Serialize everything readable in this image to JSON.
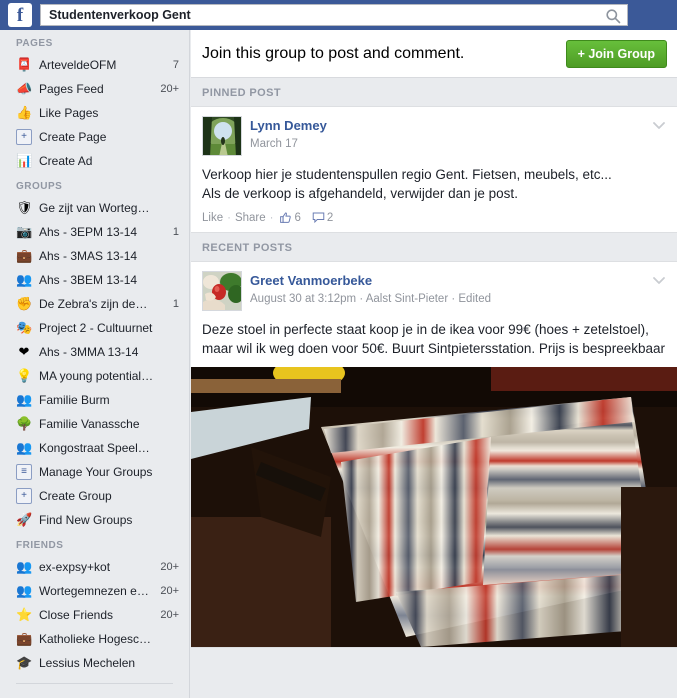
{
  "header": {
    "logo_text": "f",
    "logo_icon": "facebook-logo-icon",
    "search_value": "Studentenverkoop Gent",
    "search_placeholder": "Search",
    "search_icon": "search-icon",
    "bar_color": "#3b5998"
  },
  "sidebar": {
    "sections": [
      {
        "title": "Pages",
        "items": [
          {
            "label": "ArteveldeOFM",
            "icon": "stamp-icon",
            "glyph": "📮",
            "badge": "7",
            "boxed": false
          },
          {
            "label": "Pages Feed",
            "icon": "megaphone-icon",
            "glyph": "📣",
            "badge": "20+",
            "boxed": false
          },
          {
            "label": "Like Pages",
            "icon": "thumbs-up-icon",
            "glyph": "👍",
            "badge": "",
            "boxed": false
          },
          {
            "label": "Create Page",
            "icon": "plus-page-icon",
            "glyph": "+",
            "badge": "",
            "boxed": true
          },
          {
            "label": "Create Ad",
            "icon": "bar-chart-icon",
            "glyph": "📊",
            "badge": "",
            "boxed": false
          }
        ]
      },
      {
        "title": "Groups",
        "items": [
          {
            "label": "Ge zijt van Worteg…",
            "icon": "shield-icon",
            "glyph": "🛡",
            "badge": "",
            "boxed": false
          },
          {
            "label": "Ahs - 3EPM 13-14",
            "icon": "camera-icon",
            "glyph": "📷",
            "badge": "1",
            "boxed": false
          },
          {
            "label": "Ahs - 3MAS 13-14",
            "icon": "briefcase-icon",
            "glyph": "💼",
            "badge": "",
            "boxed": false
          },
          {
            "label": "Ahs - 3BEM 13-14",
            "icon": "group-icon",
            "glyph": "👥",
            "badge": "",
            "boxed": false
          },
          {
            "label": "De Zebra's zijn de…",
            "icon": "raised-fist-icon",
            "glyph": "✊",
            "badge": "1",
            "boxed": false
          },
          {
            "label": "Project 2 - Cultuurnet",
            "icon": "theater-masks-icon",
            "glyph": "🎭",
            "badge": "",
            "boxed": false
          },
          {
            "label": "Ahs - 3MMA 13-14",
            "icon": "heart-icon",
            "glyph": "❤",
            "badge": "",
            "boxed": false
          },
          {
            "label": "MA young potential…",
            "icon": "lightbulb-icon",
            "glyph": "💡",
            "badge": "",
            "boxed": false
          },
          {
            "label": "Familie Burm",
            "icon": "group-icon",
            "glyph": "👥",
            "badge": "",
            "boxed": false
          },
          {
            "label": "Familie Vanassche",
            "icon": "tree-icon",
            "glyph": "🌳",
            "badge": "",
            "boxed": false
          },
          {
            "label": "Kongostraat Speel…",
            "icon": "group-icon",
            "glyph": "👥",
            "badge": "",
            "boxed": false
          },
          {
            "label": "Manage Your Groups",
            "icon": "list-icon",
            "glyph": "≡",
            "badge": "",
            "boxed": true
          },
          {
            "label": "Create Group",
            "icon": "plus-group-icon",
            "glyph": "+",
            "badge": "",
            "boxed": true
          },
          {
            "label": "Find New Groups",
            "icon": "rocket-icon",
            "glyph": "🚀",
            "badge": "",
            "boxed": false
          }
        ]
      },
      {
        "title": "Friends",
        "items": [
          {
            "label": "ex-expsy+kot",
            "icon": "friend-list-icon",
            "glyph": "👥",
            "badge": "20+",
            "boxed": false
          },
          {
            "label": "Wortegemnezen e…",
            "icon": "friend-list-icon",
            "glyph": "👥",
            "badge": "20+",
            "boxed": false
          },
          {
            "label": "Close Friends",
            "icon": "star-icon",
            "glyph": "⭐",
            "badge": "20+",
            "boxed": false
          },
          {
            "label": "Katholieke Hogesc…",
            "icon": "briefcase-icon",
            "glyph": "💼",
            "badge": "",
            "boxed": false
          },
          {
            "label": "Lessius Mechelen",
            "icon": "graduation-cap-icon",
            "glyph": "🎓",
            "badge": "",
            "boxed": false
          }
        ]
      }
    ]
  },
  "main": {
    "join_bar": {
      "text": "Join this group to post and comment.",
      "button_label": "+ Join Group",
      "button_color": "#59ab2e"
    },
    "pinned_label": "Pinned Post",
    "recent_label": "Recent Posts",
    "posts": [
      {
        "author": "Lynn Demey",
        "subtitle": "March 17",
        "avatar_icon": "avatar-nature-path",
        "body": "Verkoop hier je studentenspullen regio Gent. Fietsen, meubels, etc...\nAls de verkoop is afgehandeld, verwijder dan je post.",
        "like_label": "Like",
        "share_label": "Share",
        "like_count": "6",
        "comment_count": "2",
        "menu_icon": "chevron-down-icon",
        "has_photo": false
      },
      {
        "author": "Greet Vanmoerbeke",
        "subtitle": "August 30 at 3:12pm · Aalst Sint-Pieter · Edited",
        "avatar_icon": "avatar-hands-peppers",
        "body": "Deze stoel in perfecte staat koop je in de ikea voor 99€ (hoes + zetelstoel), maar wil ik weg doen voor 50€. Buurt Sintpietersstation. Prijs is bespreekbaar",
        "menu_icon": "chevron-down-icon",
        "has_photo": true,
        "photo_alt": "striped-upholstered-chair-photo"
      }
    ]
  }
}
